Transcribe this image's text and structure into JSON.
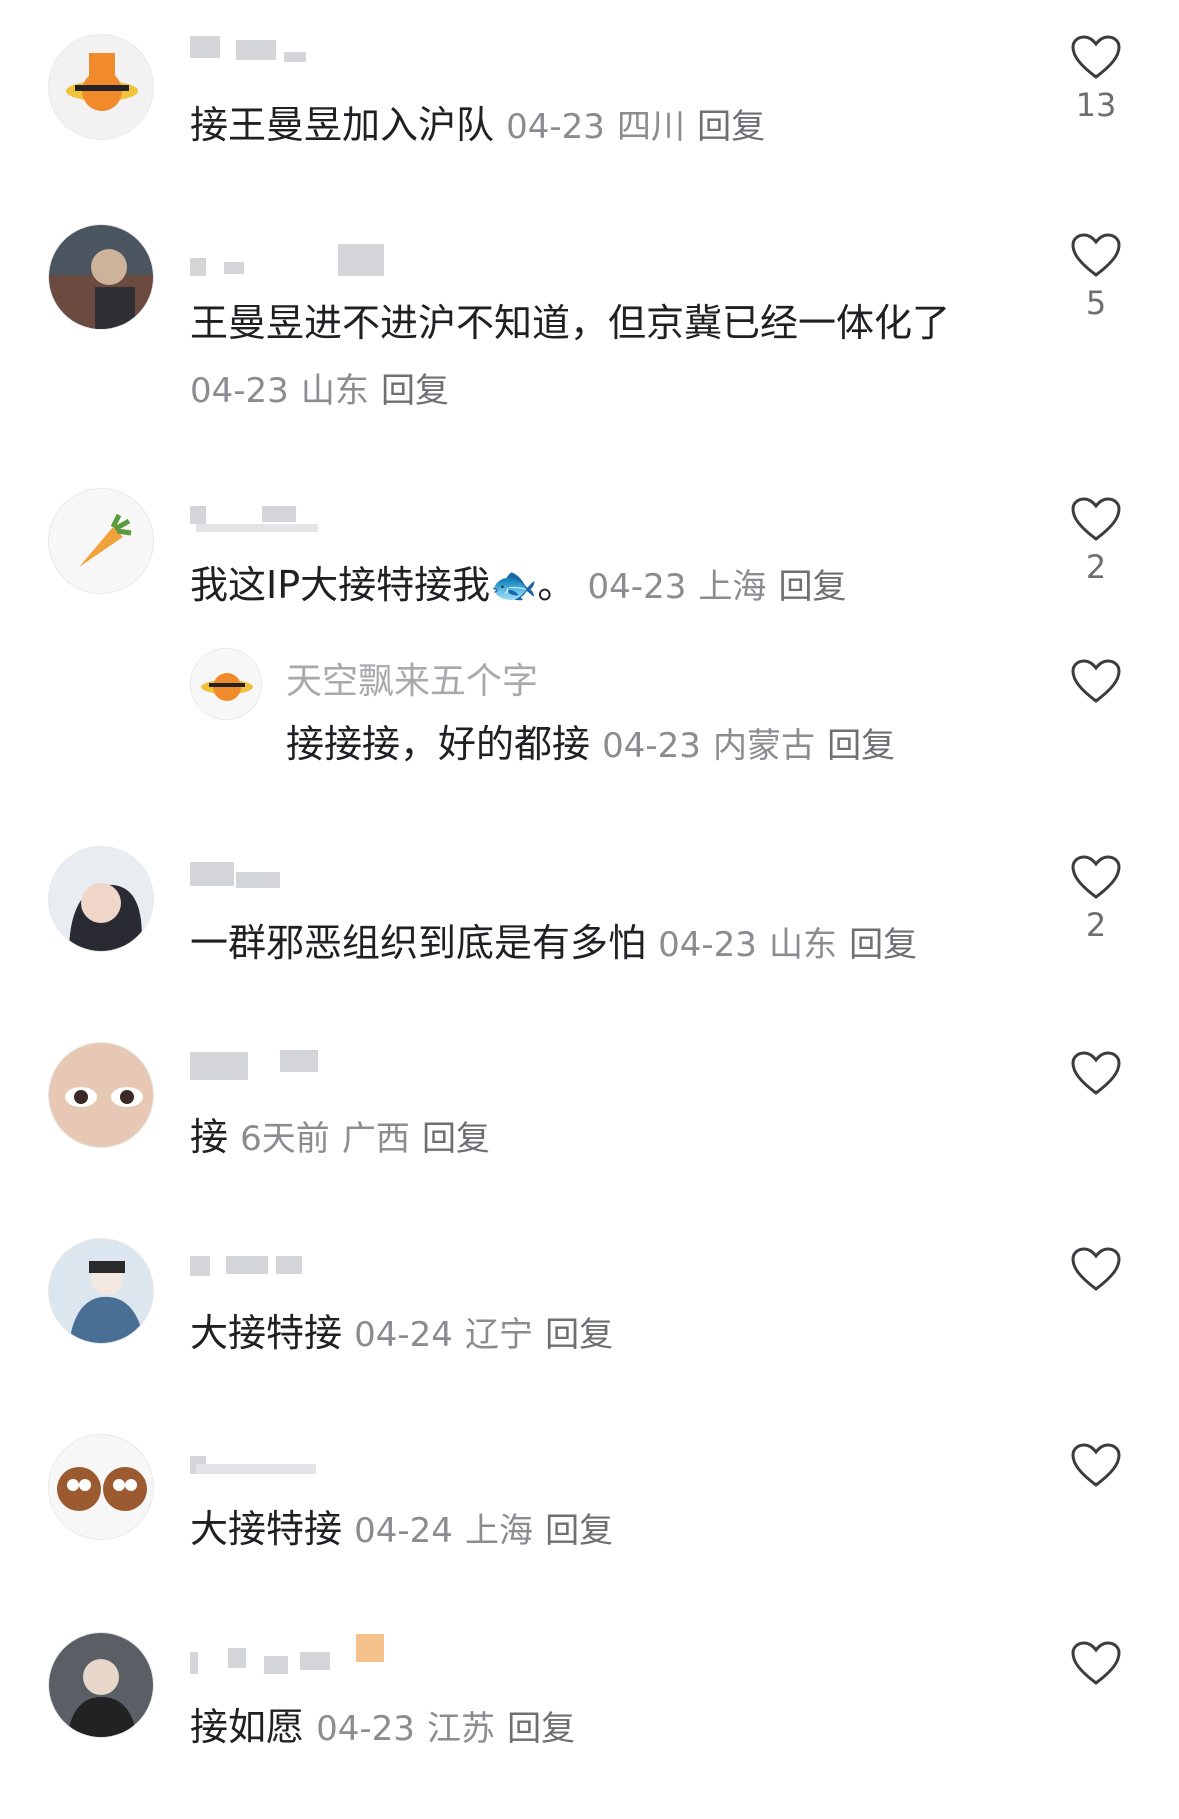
{
  "comments": [
    {
      "username": "",
      "text": "接王曼昱加入沪队",
      "date": "04-23",
      "location": "四川",
      "reply": "回复",
      "likes": "13"
    },
    {
      "username": "",
      "text": "王曼昱进不进沪不知道，但京冀已经一体化了",
      "date": "04-23",
      "location": "山东",
      "reply": "回复",
      "likes": "5"
    },
    {
      "username": "",
      "text": "我这IP大接特接我🐟。",
      "date": "04-23",
      "location": "上海",
      "reply": "回复",
      "likes": "2"
    },
    {
      "username": "天空飘来五个字",
      "text": "接接接，好的都接",
      "date": "04-23",
      "location": "内蒙古",
      "reply": "回复",
      "likes": ""
    },
    {
      "username": "",
      "text": "一群邪恶组织到底是有多怕",
      "date": "04-23",
      "location": "山东",
      "reply": "回复",
      "likes": "2"
    },
    {
      "username": "",
      "text": "接",
      "date": "6天前",
      "location": "广西",
      "reply": "回复",
      "likes": ""
    },
    {
      "username": "",
      "text": "大接特接",
      "date": "04-24",
      "location": "辽宁",
      "reply": "回复",
      "likes": ""
    },
    {
      "username": "",
      "text": "大接特接",
      "date": "04-24",
      "location": "上海",
      "reply": "回复",
      "likes": ""
    },
    {
      "username": "",
      "text": "接如愿",
      "date": "04-23",
      "location": "江苏",
      "reply": "回复",
      "likes": ""
    }
  ],
  "icons": {
    "like": "heart-outline-icon"
  },
  "colors": {
    "meta": "#8a8c92",
    "text": "#1f1f24",
    "icon": "#3b3d42"
  }
}
